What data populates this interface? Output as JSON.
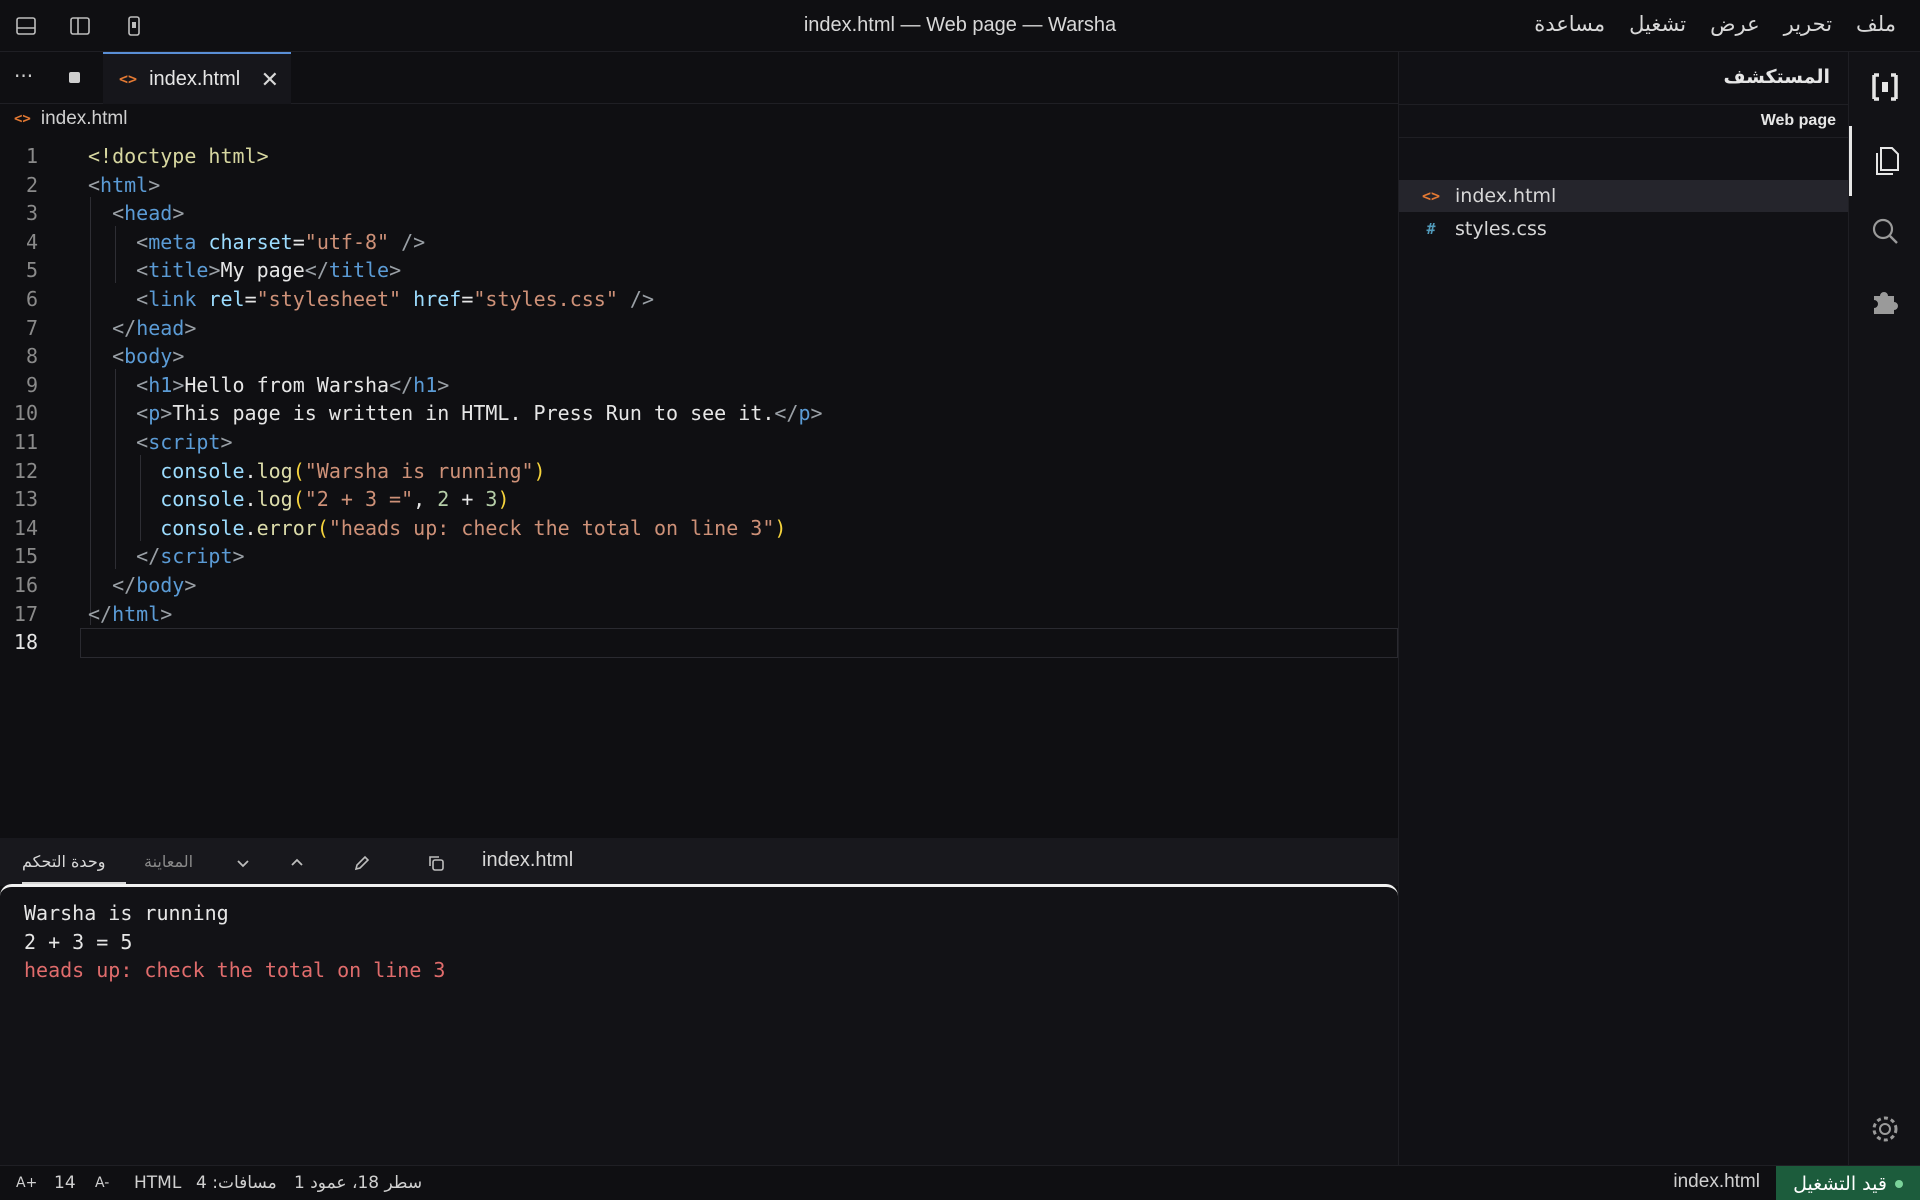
{
  "window": {
    "title": "index.html — Web page — Warsha"
  },
  "menu": [
    "ملف",
    "تحرير",
    "عرض",
    "تشغيل",
    "مساعدة"
  ],
  "sidebar": {
    "title": "المستكشف",
    "section": "Web page",
    "files": [
      {
        "name": "index.html",
        "icon": "<>"
      },
      {
        "name": "styles.css",
        "icon": "#"
      }
    ]
  },
  "editor": {
    "tab": {
      "label": "index.html",
      "close": "✕"
    },
    "more": "···",
    "breadcrumb": "index.html",
    "current_line": 18
  },
  "panel": {
    "tabs": {
      "console": "وحدة التحكم",
      "preview": "المعاينة"
    },
    "file": "index.html",
    "output": [
      {
        "text": "Warsha is running",
        "kind": "log"
      },
      {
        "text": "2 + 3 = 5",
        "kind": "log"
      },
      {
        "text": "heads up: check the total on line 3",
        "kind": "error"
      }
    ]
  },
  "status": {
    "run_state": "قيد التشغيل",
    "file": "index.html",
    "position": "سطر 18، عمود 1",
    "spaces": "مسافات: 4",
    "language": "HTML",
    "font_decrease": "A-",
    "font_size": "14",
    "font_increase": "A+"
  },
  "colors": {
    "accent": "#5a8fd6",
    "run_bg": "#1c5c3c",
    "error": "#e06c6c",
    "icon_html": "#e37933",
    "icon_css": "#519aba"
  }
}
